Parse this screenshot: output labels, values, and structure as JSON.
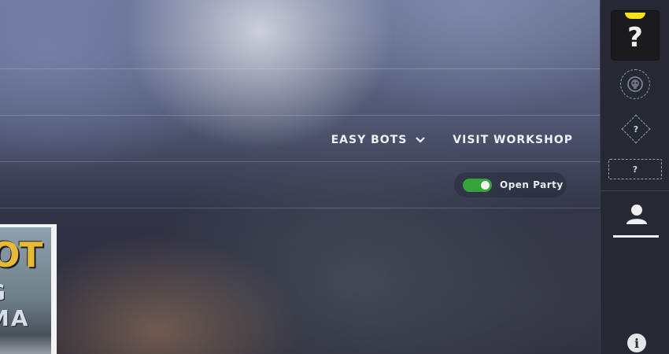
{
  "header": {
    "difficulty_label": "EASY BOTS",
    "difficulty_icon": "chevron-down-icon",
    "workshop_label": "VISIT WORKSHOP"
  },
  "party": {
    "label": "Open Party",
    "enabled": true,
    "toggle_color": "#35a53a"
  },
  "map_card": {
    "title_fragment_1": "OT",
    "title_fragment_2": "G MA"
  },
  "sidebar": {
    "rank_text": "?",
    "rank_marker_color": "#f5e21a",
    "medal_icon": "emblem-placeholder-icon",
    "diamond_text": "?",
    "slot_text": "?",
    "profile_icon": "user-icon",
    "info_text": "i"
  }
}
